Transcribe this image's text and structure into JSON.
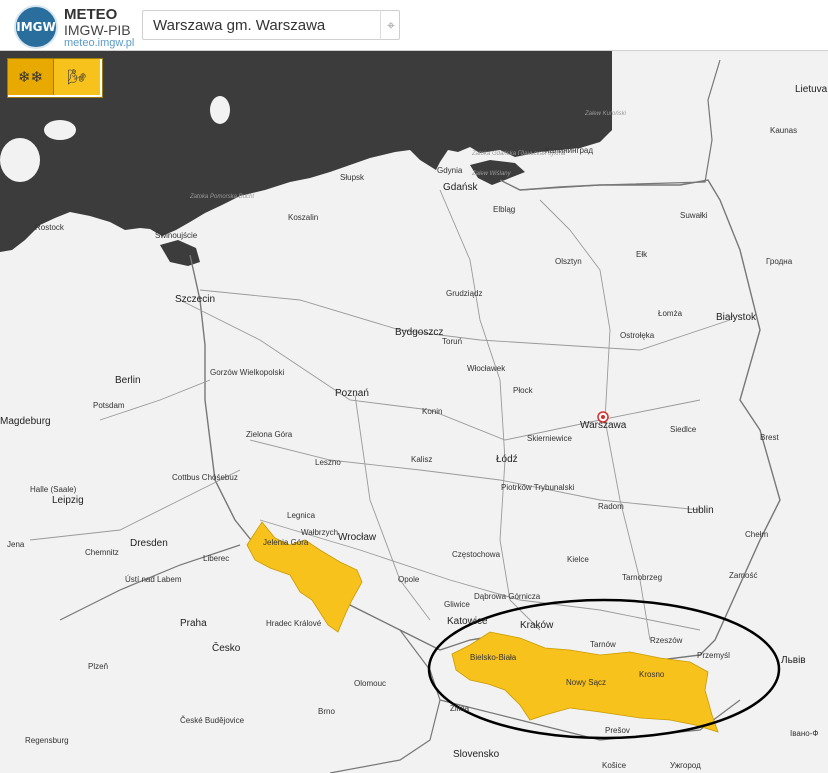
{
  "header": {
    "brand_line1": "METEO",
    "brand_line2": "IMGW-PIB",
    "brand_url": "meteo.imgw.pl",
    "logo_text": "IMGW",
    "search_value": "Warszawa gm. Warszawa"
  },
  "warnings": {
    "frost_icon": "snowflakes-icon",
    "wind_icon": "windsock-icon",
    "frost_glyph": "❄❄",
    "wind_glyph": "🌬",
    "color_warning_fill": "#f8c21d",
    "color_active_button": "#e8a900"
  },
  "map": {
    "selected_location": "Warszawa",
    "sea_color": "#3c3c3c",
    "land_color": "#f2f2f2",
    "warning_area_color": "#f8c21d",
    "highlight_ellipse_color": "#000000",
    "sea_labels": [
      "Zatoka Pomorska Bucht",
      "Zatoka Gdańska Гданьская бухта",
      "Zalew Kuroński",
      "Zalew Wiślany"
    ],
    "cities": [
      "Słupsk",
      "Gdynia",
      "Gdańsk",
      "Koszalin",
      "Elbląg",
      "Калининград",
      "Suwałki",
      "Kaunas",
      "Lietuva",
      "Olsztyn",
      "Гродна",
      "Ełk",
      "Rostock",
      "Świnoujście",
      "Szczecin",
      "Gorzów Wielkopolski",
      "Grudziądz",
      "Bydgoszcz",
      "Toruń",
      "Łomża",
      "Białystok",
      "Ostrołęka",
      "Włocławek",
      "Berlin",
      "Potsdam",
      "Poznań",
      "Płock",
      "Konin",
      "Warszawa",
      "Siedlce",
      "Brest",
      "Magdeburg",
      "Zielona Góra",
      "Leszno",
      "Kalisz",
      "Łódź",
      "Skierniewice",
      "Lublin",
      "Cottbus Chóśebuz",
      "Halle (Saale)",
      "Leipzig",
      "Piotrków Trybunalski",
      "Radom",
      "Legnica",
      "Wrocław",
      "Dresden",
      "Jelenia Góra",
      "Wałbrzych",
      "Częstochowa",
      "Kielce",
      "Chełm",
      "Jena",
      "Chemnitz",
      "Liberec",
      "Opole",
      "Zamość",
      "Ústí nad Labem",
      "Tarnobrzeg",
      "Dąbrowa Górnicza",
      "Gliwice",
      "Katowice",
      "Kraków",
      "Rzeszów",
      "Praha",
      "Hradec Králové",
      "Tarnów",
      "Przemyśl",
      "Bielsko-Biała",
      "Львів",
      "Česko",
      "Olomouc",
      "Nowy Sącz",
      "Krosno",
      "Plzeň",
      "Brno",
      "Žilina",
      "Prešov",
      "České Budějovice",
      "Regensburg",
      "Slovensko",
      "Košice",
      "Ужгород",
      "Івано-Ф"
    ]
  }
}
